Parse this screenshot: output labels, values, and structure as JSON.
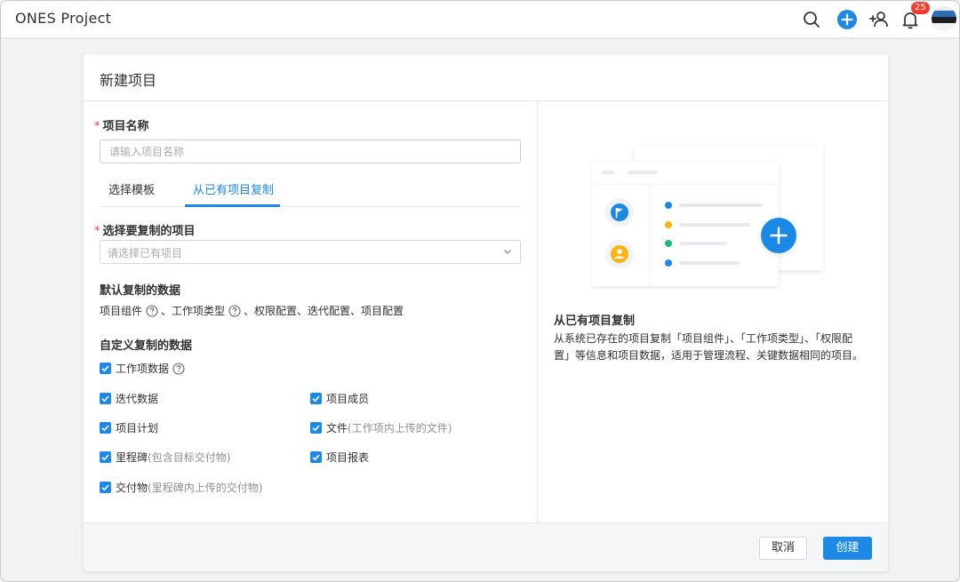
{
  "app": {
    "title": "ONES Project",
    "notification_count": "25"
  },
  "icons": {
    "search": "search-icon",
    "add": "plus-circle-icon",
    "invite": "add-user-icon",
    "bell": "bell-icon",
    "accent": "#1e88e5"
  },
  "dialog": {
    "title": "新建项目",
    "name_label": "项目名称",
    "name_placeholder": "请输入项目名称",
    "tabs": [
      "选择模板",
      "从已有项目复制"
    ],
    "active_tab": 1,
    "copy_label": "选择要复制的项目",
    "copy_placeholder": "请选择已有项目",
    "default_title": "默认复制的数据",
    "default_items": {
      "part1": "项目组件",
      "part2": "、工作项类型",
      "part3": "、权限配置、迭代配置、项目配置"
    },
    "custom_title": "自定义复制的数据",
    "custom_items": {
      "work_items": "工作项数据",
      "iterations": "迭代数据",
      "members": "项目成员",
      "plans": "项目计划",
      "files": "文件",
      "files_note": "(工作项内上传的文件)",
      "milestones": "里程碑",
      "milestones_note": "(包含目标交付物)",
      "reports": "项目报表",
      "deliverables": "交付物",
      "deliverables_note": "(里程碑内上传的交付物)"
    },
    "right_title": "从已有项目复制",
    "right_desc": "从系统已存在的项目复制「项目组件」、「工作项类型」、「权限配置」等信息和项目数据，适用于管理流程、关键数据相同的项目。",
    "cancel_label": "取消",
    "create_label": "创建"
  }
}
